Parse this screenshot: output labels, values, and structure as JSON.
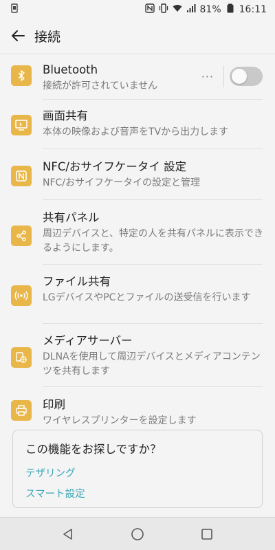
{
  "status_bar": {
    "battery_percent": "81%",
    "time": "16:11"
  },
  "app_bar": {
    "title": "接続",
    "back_icon": "arrow-left-icon"
  },
  "items": [
    {
      "title": "Bluetooth",
      "subtitle": "接続が許可されていません",
      "icon": "bluetooth-icon",
      "toggle_on": false,
      "more_label": "···"
    },
    {
      "title": "画面共有",
      "subtitle": "本体の映像および音声をTVから出力します",
      "icon": "screen-cast-icon"
    },
    {
      "title": "NFC/おサイフケータイ 設定",
      "subtitle": "NFC/おサイフケータイの設定と管理",
      "icon": "nfc-icon"
    },
    {
      "title": "共有パネル",
      "subtitle": "周辺デバイスと、特定の人を共有パネルに表示できるようにします。",
      "icon": "share-icon"
    },
    {
      "title": "ファイル共有",
      "subtitle": "LGデバイスやPCとファイルの送受信を行います",
      "icon": "wireless-share-icon"
    },
    {
      "title": "メディアサーバー",
      "subtitle": "DLNAを使用して周辺デバイスとメディアコンテンツを共有します",
      "icon": "media-server-icon"
    },
    {
      "title": "印刷",
      "subtitle": "ワイヤレスプリンターを設定します",
      "icon": "printer-icon"
    }
  ],
  "suggestion": {
    "title": "この機能をお探しですか？",
    "links": [
      "テザリング",
      "スマート設定"
    ]
  },
  "colors": {
    "accent_icon_bg": "#e9b64a",
    "link": "#3aa6b9",
    "background": "#f4f4f4"
  }
}
